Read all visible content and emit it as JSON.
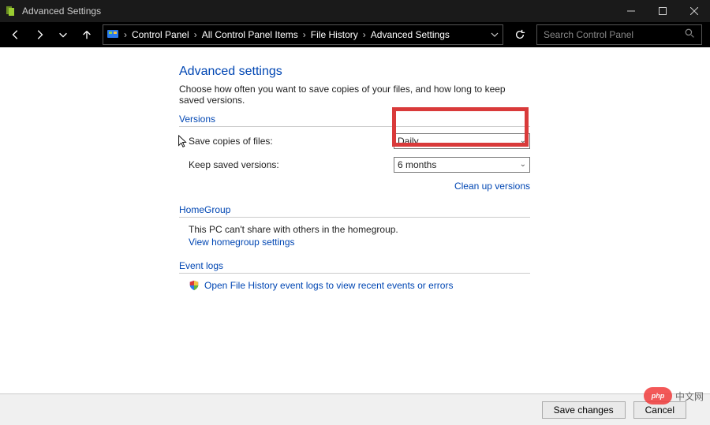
{
  "window": {
    "title": "Advanced Settings"
  },
  "nav": {
    "breadcrumbs": [
      "Control Panel",
      "All Control Panel Items",
      "File History",
      "Advanced Settings"
    ],
    "search_placeholder": "Search Control Panel"
  },
  "page": {
    "heading": "Advanced settings",
    "description": "Choose how often you want to save copies of your files, and how long to keep saved versions."
  },
  "versions": {
    "section_label": "Versions",
    "save_copies_label": "Save copies of files:",
    "save_copies_value": "Daily",
    "keep_versions_label": "Keep saved versions:",
    "keep_versions_value": "6 months",
    "cleanup_link": "Clean up versions"
  },
  "homegroup": {
    "section_label": "HomeGroup",
    "text": "This PC can't share with others in the homegroup.",
    "link": "View homegroup settings"
  },
  "eventlogs": {
    "section_label": "Event logs",
    "link": "Open File History event logs to view recent events or errors"
  },
  "buttons": {
    "save": "Save changes",
    "cancel": "Cancel"
  },
  "watermark": {
    "logo": "php",
    "text": "中文网"
  }
}
